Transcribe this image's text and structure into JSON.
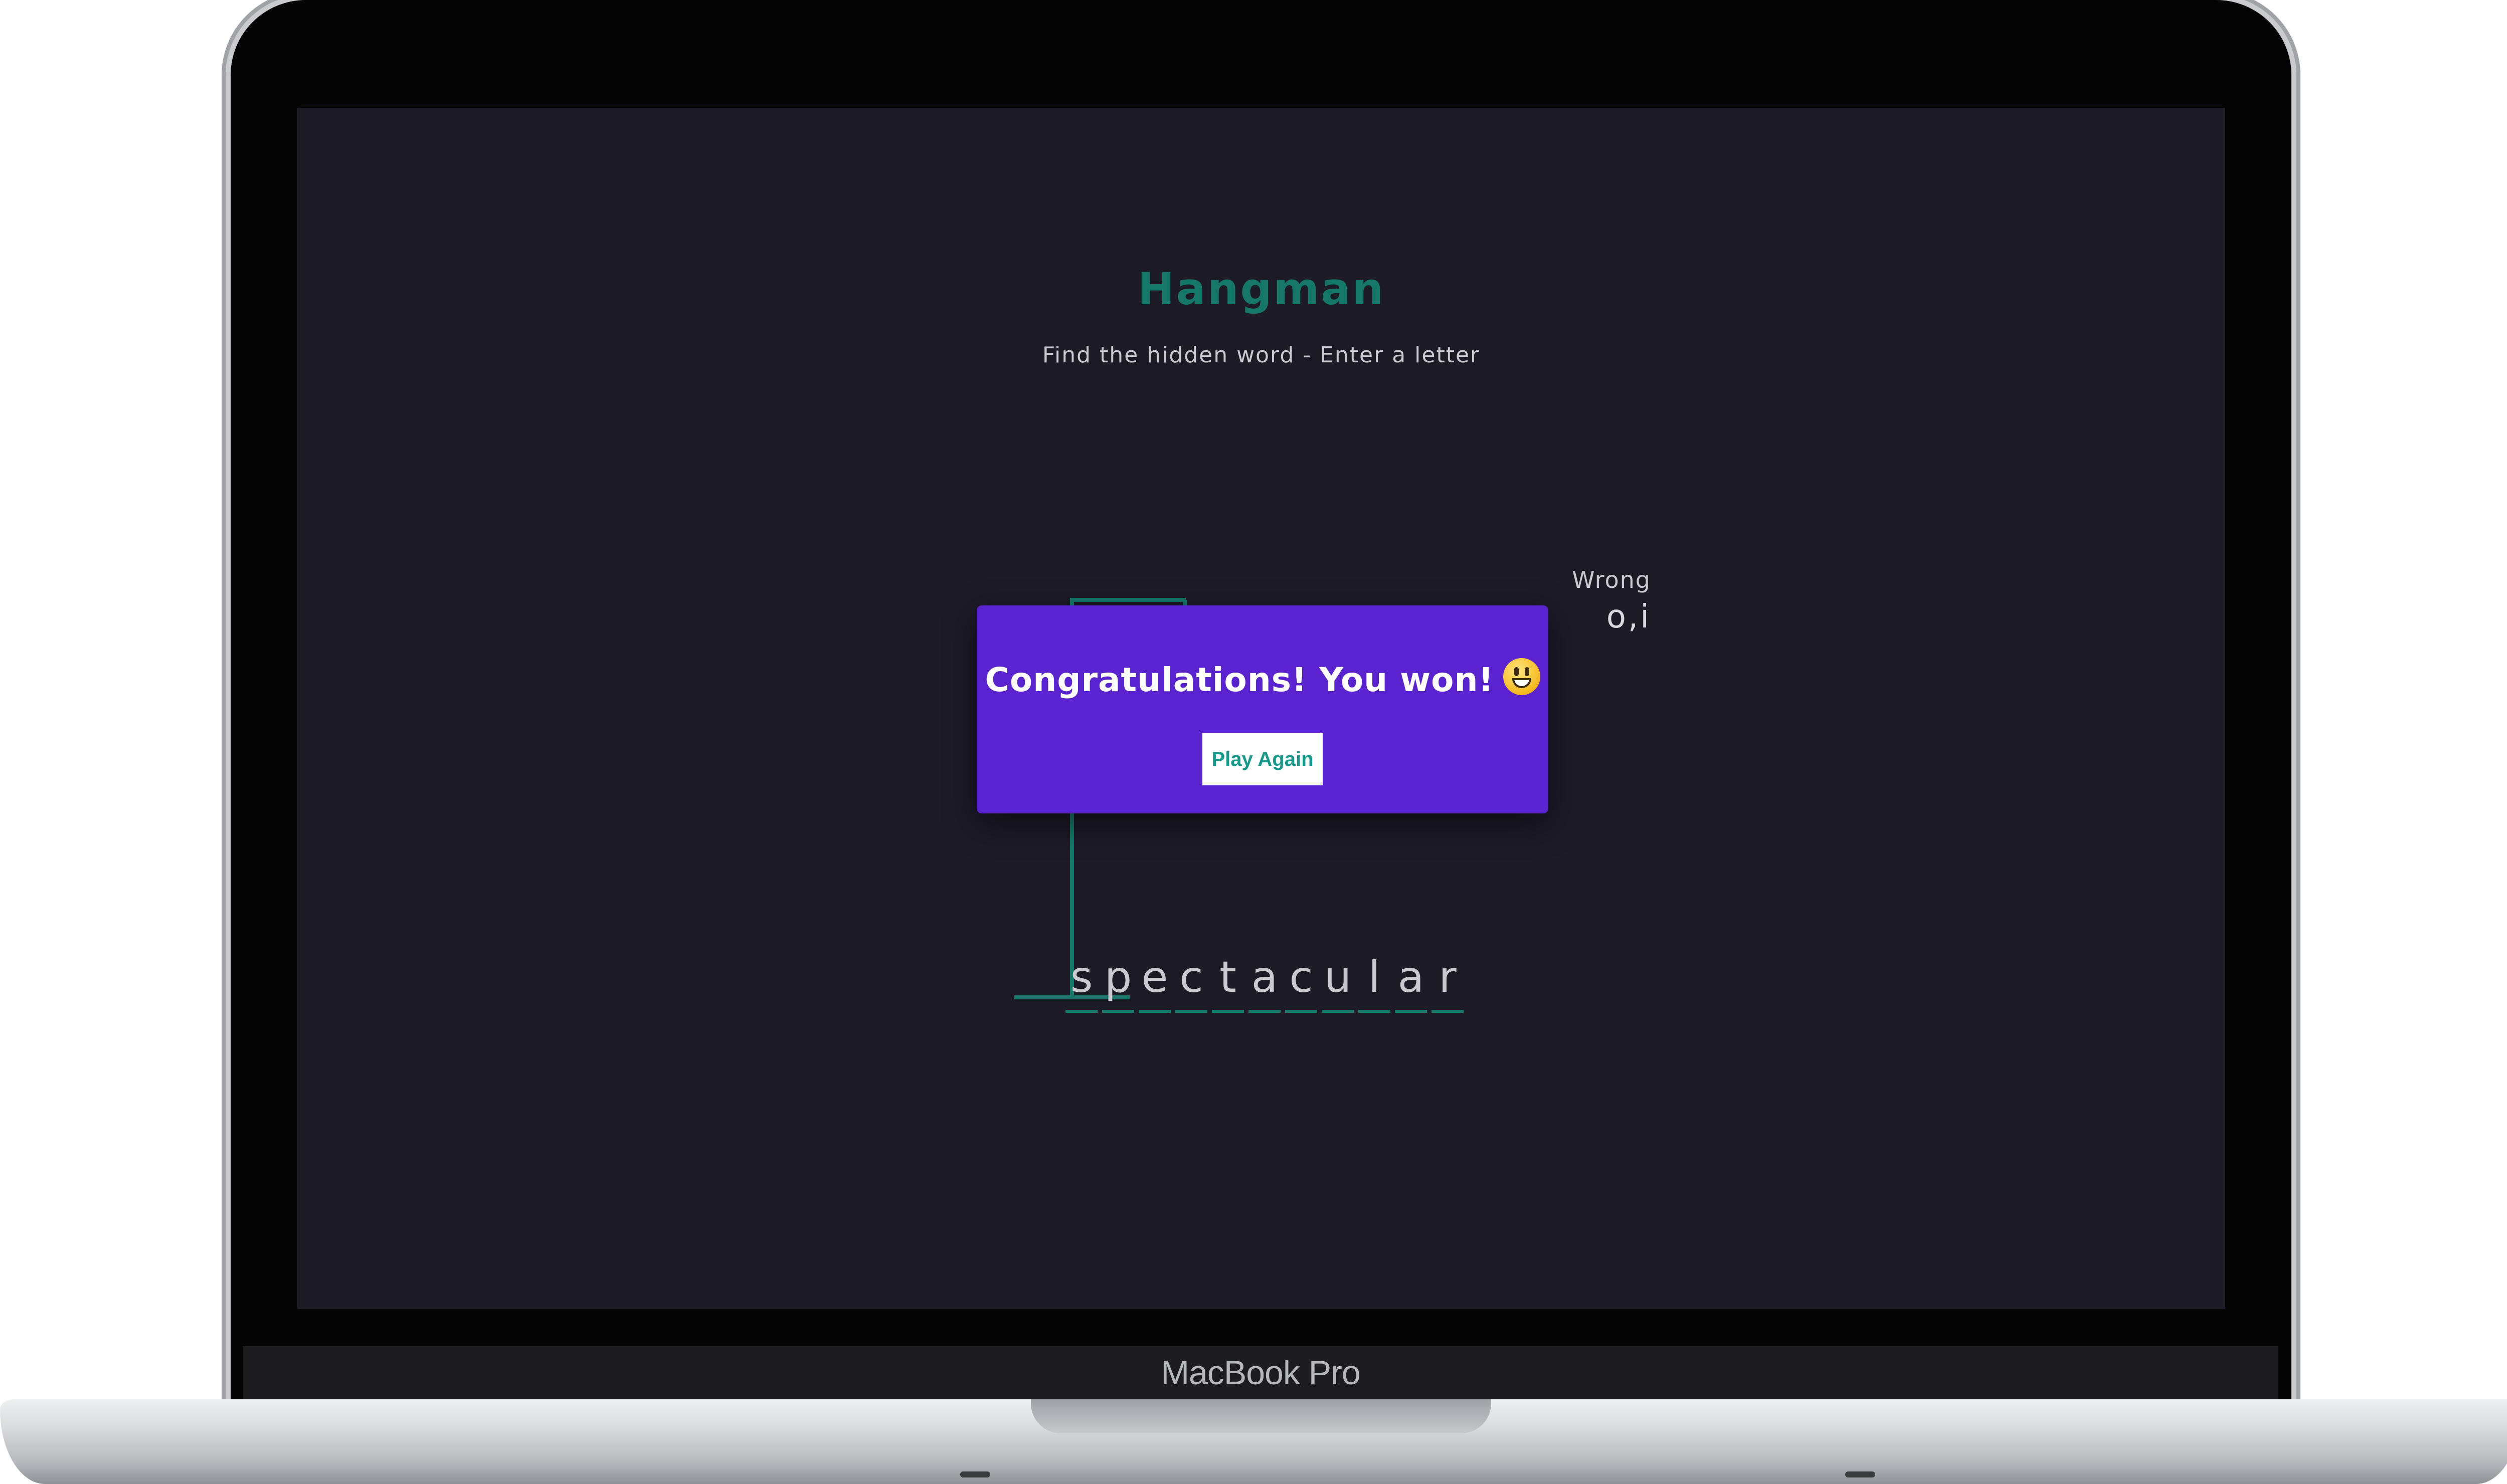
{
  "device": {
    "label": "MacBook Pro"
  },
  "game": {
    "title": "Hangman",
    "subtitle": "Find the hidden word - Enter a letter",
    "wrong_label": "Wrong",
    "wrong_letters": "o,i",
    "word_letters": [
      "s",
      "p",
      "e",
      "c",
      "t",
      "a",
      "c",
      "u",
      "l",
      "a",
      "r"
    ]
  },
  "popup": {
    "message": "Congratulations! You won!",
    "emoji_icon": "grinning-face-icon",
    "play_again_label": "Play Again"
  },
  "colors": {
    "background": "#1c1b26",
    "accent": "#15766a",
    "popup": "#5a23cf",
    "button_text": "#14998a"
  }
}
